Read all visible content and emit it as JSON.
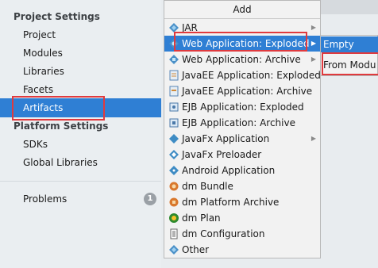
{
  "sidebar": {
    "project_settings_title": "Project Settings",
    "project_items": [
      "Project",
      "Modules",
      "Libraries",
      "Facets",
      "Artifacts"
    ],
    "platform_settings_title": "Platform Settings",
    "platform_items": [
      "SDKs",
      "Global Libraries"
    ],
    "problems_label": "Problems",
    "problems_count": "1",
    "selected_item": "Artifacts"
  },
  "popup": {
    "title": "Add",
    "items": [
      {
        "label": "JAR",
        "icon": "jar-icon",
        "has_submenu": true
      },
      {
        "label": "Web Application: Exploded",
        "icon": "web-exploded-icon",
        "has_submenu": true,
        "selected": true
      },
      {
        "label": "Web Application: Archive",
        "icon": "web-archive-icon",
        "has_submenu": true
      },
      {
        "label": "JavaEE Application: Exploded",
        "icon": "javaee-exploded-icon"
      },
      {
        "label": "JavaEE Application: Archive",
        "icon": "javaee-archive-icon"
      },
      {
        "label": "EJB Application: Exploded",
        "icon": "ejb-exploded-icon"
      },
      {
        "label": "EJB Application: Archive",
        "icon": "ejb-archive-icon"
      },
      {
        "label": "JavaFx Application",
        "icon": "javafx-app-icon",
        "has_submenu": true
      },
      {
        "label": "JavaFx Preloader",
        "icon": "javafx-preloader-icon"
      },
      {
        "label": "Android Application",
        "icon": "android-app-icon"
      },
      {
        "label": "dm Bundle",
        "icon": "dm-bundle-icon"
      },
      {
        "label": "dm Platform Archive",
        "icon": "dm-platform-icon"
      },
      {
        "label": "dm Plan",
        "icon": "dm-plan-icon"
      },
      {
        "label": "dm Configuration",
        "icon": "dm-config-icon"
      },
      {
        "label": "Other",
        "icon": "other-icon"
      }
    ]
  },
  "submenu": {
    "items": [
      {
        "label": "Empty",
        "selected": true
      },
      {
        "label": "From Modu"
      }
    ]
  },
  "colors": {
    "selection": "#2f7fd4",
    "highlight_box": "#e03a3e"
  }
}
